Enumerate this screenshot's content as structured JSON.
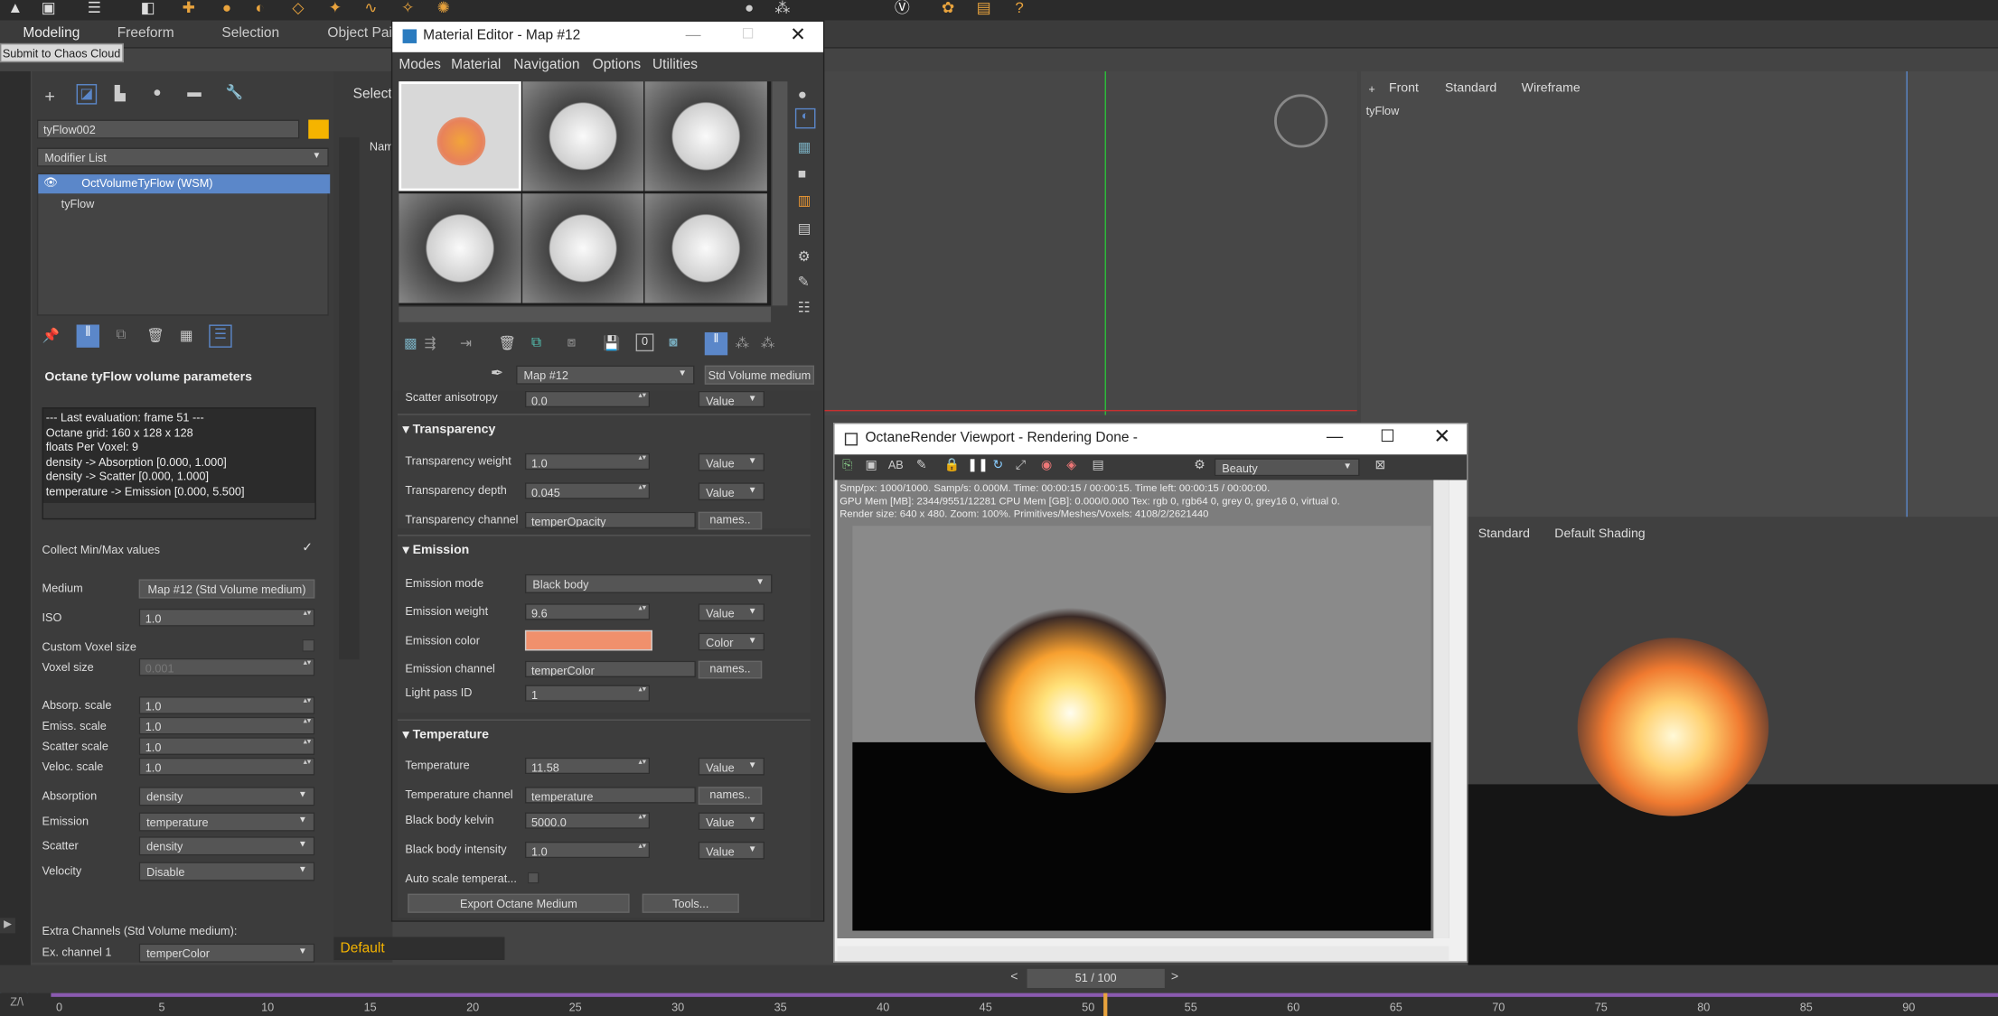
{
  "ribbon": {
    "tabs": [
      "Modeling",
      "Freeform",
      "Selection",
      "Object Pai"
    ],
    "tooltip": "Submit to Chaos Cloud"
  },
  "command_panel": {
    "object_name": "tyFlow002",
    "modifier_list": "Modifier List",
    "stack": [
      "OctVolumeTyFlow (WSM)",
      "tyFlow"
    ]
  },
  "rollout": {
    "title": "Octane tyFlow volume parameters",
    "log": [
      "--- Last evaluation: frame 51 ---",
      "Octane grid: 160 x 128 x 128",
      "floats Per Voxel: 9",
      "density -> Absorption [0.000, 1.000]",
      "density -> Scatter [0.000, 1.000]",
      "temperature -> Emission [0.000, 5.500]"
    ],
    "collect_minmax": "Collect Min/Max values",
    "medium_label": "Medium",
    "medium_value": "Map #12 (Std Volume medium)",
    "iso_label": "ISO",
    "iso_value": "1.0",
    "custom_voxel": "Custom Voxel size",
    "voxel_label": "Voxel size",
    "voxel_value": "0.001",
    "absorp_label": "Absorp. scale",
    "absorp_value": "1.0",
    "emiss_label": "Emiss. scale",
    "emiss_value": "1.0",
    "scatter_scale_label": "Scatter scale",
    "scatter_scale_value": "1.0",
    "veloc_label": "Veloc. scale",
    "veloc_value": "1.0",
    "absorption_label": "Absorption",
    "absorption_value": "density",
    "emission_label": "Emission",
    "emission_value": "temperature",
    "scatter_label": "Scatter",
    "scatter_value": "density",
    "velocity_label": "Velocity",
    "velocity_value": "Disable",
    "extra_channels": "Extra Channels (Std Volume medium):",
    "ex1_label": "Ex. channel 1",
    "ex1_value": "temperColor"
  },
  "scene_explorer": {
    "select": "Select",
    "name_col": "Nam",
    "default_layer": "Default"
  },
  "mat_editor": {
    "title": "Material Editor - Map #12",
    "menu": [
      "Modes",
      "Material",
      "Navigation",
      "Options",
      "Utilities"
    ],
    "map_name": "Map #12",
    "map_type": "Std Volume medium",
    "scatter_aniso_label": "Scatter anisotropy",
    "scatter_aniso_value": "0.0",
    "scatter_aniso_mode": "Value",
    "transparency_title": "Transparency",
    "tw_label": "Transparency weight",
    "tw_value": "1.0",
    "tw_mode": "Value",
    "td_label": "Transparency depth",
    "td_value": "0.045",
    "td_mode": "Value",
    "tc_label": "Transparency channel",
    "tc_value": "temperOpacity",
    "tc_btn": "names..",
    "emission_title": "Emission",
    "em_mode_label": "Emission mode",
    "em_mode_value": "Black body",
    "em_weight_label": "Emission weight",
    "em_weight_value": "9.6",
    "em_weight_mode": "Value",
    "em_color_label": "Emission color",
    "em_color": "#f0906c",
    "em_color_mode": "Color",
    "em_channel_label": "Emission channel",
    "em_channel_value": "temperColor",
    "em_channel_btn": "names..",
    "light_pass_label": "Light pass ID",
    "light_pass_value": "1",
    "temperature_title": "Temperature",
    "temp_label": "Temperature",
    "temp_value": "11.58",
    "temp_mode": "Value",
    "temp_ch_label": "Temperature channel",
    "temp_ch_value": "temperature",
    "temp_ch_btn": "names..",
    "bbk_label": "Black body kelvin",
    "bbk_value": "5000.0",
    "bbk_mode": "Value",
    "bbi_label": "Black body intensity",
    "bbi_value": "1.0",
    "bbi_mode": "Value",
    "auto_scale_label": "Auto scale temperat...",
    "export_btn": "Export Octane Medium",
    "tools_btn": "Tools..."
  },
  "octane": {
    "title": "OctaneRender Viewport - Rendering Done -",
    "pass": "Beauty",
    "stats": [
      "Smp/px: 1000/1000.  Samp/s: 0.000M.  Time: 00:00:15 / 00:00:15.  Time left: 00:00:15 / 00:00:00.",
      "GPU Mem [MB]: 2344/9551/12281  CPU Mem [GB]: 0.000/0.000  Tex: rgb 0, rgb64 0, grey 0, grey16 0, virtual 0.",
      "Render size: 640 x 480.  Zoom: 100%.  Primitives/Meshes/Voxels: 4108/2/2621440"
    ]
  },
  "viewports": {
    "front": {
      "plus": "+",
      "view": "Front",
      "mode": "Standard",
      "shade": "Wireframe",
      "label": "tyFlow"
    },
    "persp": {
      "mode": "Standard",
      "shade": "Default Shading"
    }
  },
  "timeline": {
    "frame": "51 / 100",
    "ticks": [
      "0",
      "5",
      "10",
      "15",
      "20",
      "25",
      "30",
      "35",
      "40",
      "45",
      "50",
      "55",
      "60",
      "65",
      "70",
      "75",
      "80",
      "85",
      "90"
    ]
  },
  "colors": {
    "accent": "#5b87c9",
    "object_swatch": "#f5b400",
    "emission": "#f0906c"
  }
}
